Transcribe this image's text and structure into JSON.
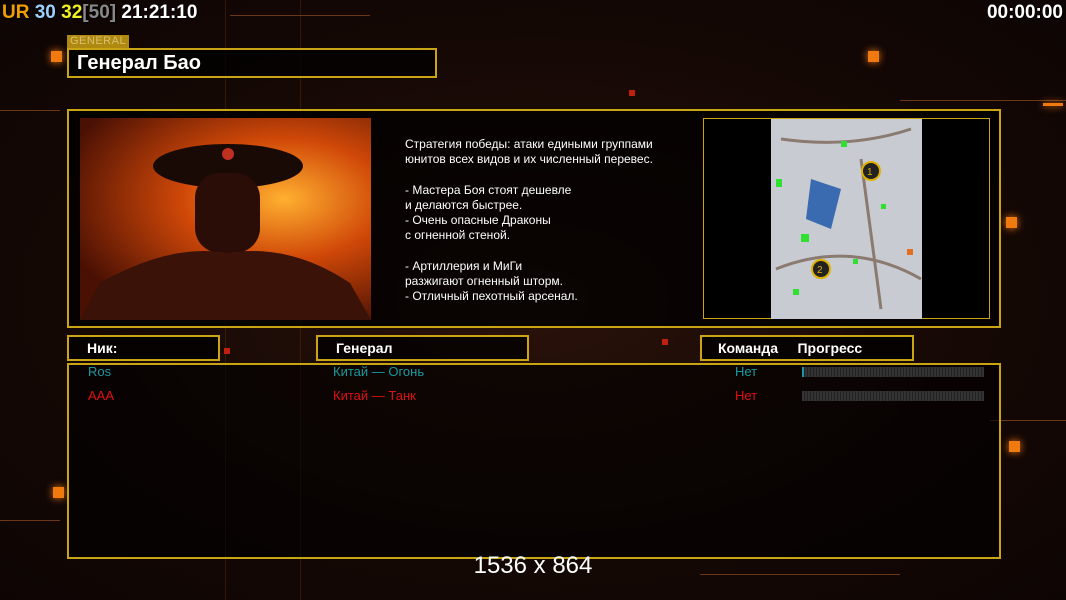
{
  "hud": {
    "ur": "UR",
    "fps": "30",
    "fps2": "32",
    "limit": "[50]",
    "clock": "21:21:10",
    "timer": "00:00:00"
  },
  "general": {
    "tag": "GENERAL",
    "name": "Генерал Бао",
    "description": "Стратегия победы: атаки едиными группами\nюнитов всех видов и их численный перевес.\n\n- Мастера Боя стоят дешевле\nи делаются быстрее.\n- Очень опасные Драконы\nс огненной стеной.\n\n- Артиллерия и МиГи\nразжигают огненный шторм.\n- Отличный пехотный арсенал."
  },
  "map": {
    "markers": [
      "1",
      "2"
    ]
  },
  "table": {
    "col_nick": "Ник:",
    "col_general": "Генерал",
    "col_team": "Команда",
    "col_progress": "Прогресс",
    "rows": [
      {
        "nick": "Ros",
        "general": "Китай — Огонь",
        "team": "Нет",
        "progress": 0.01,
        "color": "#1a9aa0"
      },
      {
        "nick": "AAA",
        "general": "Китай — Танк",
        "team": "Нет",
        "progress": 0,
        "color": "#e01010"
      }
    ]
  },
  "resolution": "1536 x 864"
}
